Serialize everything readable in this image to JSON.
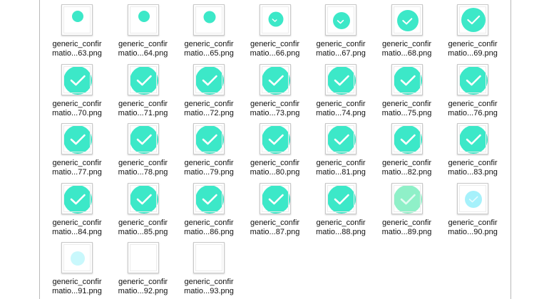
{
  "files": [
    {
      "line1": "generic_confir",
      "line2": "matio...63.png",
      "icon": "teal-dot-small"
    },
    {
      "line1": "generic_confir",
      "line2": "matio...64.png",
      "icon": "teal-dot-small"
    },
    {
      "line1": "generic_confir",
      "line2": "matio...65.png",
      "icon": "teal-dot-small"
    },
    {
      "line1": "generic_confir",
      "line2": "matio...66.png",
      "icon": "check-circle-partial"
    },
    {
      "line1": "generic_confir",
      "line2": "matio...67.png",
      "icon": "check-circle-partial"
    },
    {
      "line1": "generic_confir",
      "line2": "matio...68.png",
      "icon": "check-circle-partial"
    },
    {
      "line1": "generic_confir",
      "line2": "matio...69.png",
      "icon": "check-circle"
    },
    {
      "line1": "generic_confir",
      "line2": "matio...70.png",
      "icon": "check-circle"
    },
    {
      "line1": "generic_confir",
      "line2": "matio...71.png",
      "icon": "check-circle"
    },
    {
      "line1": "generic_confir",
      "line2": "matio...72.png",
      "icon": "check-circle"
    },
    {
      "line1": "generic_confir",
      "line2": "matio...73.png",
      "icon": "check-circle"
    },
    {
      "line1": "generic_confir",
      "line2": "matio...74.png",
      "icon": "check-circle"
    },
    {
      "line1": "generic_confir",
      "line2": "matio...75.png",
      "icon": "check-circle"
    },
    {
      "line1": "generic_confir",
      "line2": "matio...76.png",
      "icon": "check-circle"
    },
    {
      "line1": "generic_confir",
      "line2": "matio...77.png",
      "icon": "check-circle"
    },
    {
      "line1": "generic_confir",
      "line2": "matio...78.png",
      "icon": "check-circle"
    },
    {
      "line1": "generic_confir",
      "line2": "matio...79.png",
      "icon": "check-circle"
    },
    {
      "line1": "generic_confir",
      "line2": "matio...80.png",
      "icon": "check-circle"
    },
    {
      "line1": "generic_confir",
      "line2": "matio...81.png",
      "icon": "check-circle"
    },
    {
      "line1": "generic_confir",
      "line2": "matio...82.png",
      "icon": "check-circle"
    },
    {
      "line1": "generic_confir",
      "line2": "matio...83.png",
      "icon": "check-circle"
    },
    {
      "line1": "generic_confir",
      "line2": "matio...84.png",
      "icon": "check-circle"
    },
    {
      "line1": "generic_confir",
      "line2": "matio...85.png",
      "icon": "check-circle"
    },
    {
      "line1": "generic_confir",
      "line2": "matio...86.png",
      "icon": "check-circle"
    },
    {
      "line1": "generic_confir",
      "line2": "matio...87.png",
      "icon": "check-circle"
    },
    {
      "line1": "generic_confir",
      "line2": "matio...88.png",
      "icon": "check-circle"
    },
    {
      "line1": "generic_confir",
      "line2": "matio...89.png",
      "icon": "check-circle-faded"
    },
    {
      "line1": "generic_confir",
      "line2": "matio...90.png",
      "icon": "check-circle-faded"
    },
    {
      "line1": "generic_confir",
      "line2": "matio...91.png",
      "icon": "teal-dot-faded"
    },
    {
      "line1": "generic_confir",
      "line2": "matio...92.png",
      "icon": "blank-image"
    },
    {
      "line1": "generic_confir",
      "line2": "matio...93.png",
      "icon": "blank-image"
    }
  ],
  "colors": {
    "teal": "#3ce8c8",
    "teal_faded": "#8ff0c8",
    "cyan_faded": "#a6f1fb",
    "cyan_pale": "#c9f8fc",
    "check": "#ffffff"
  }
}
